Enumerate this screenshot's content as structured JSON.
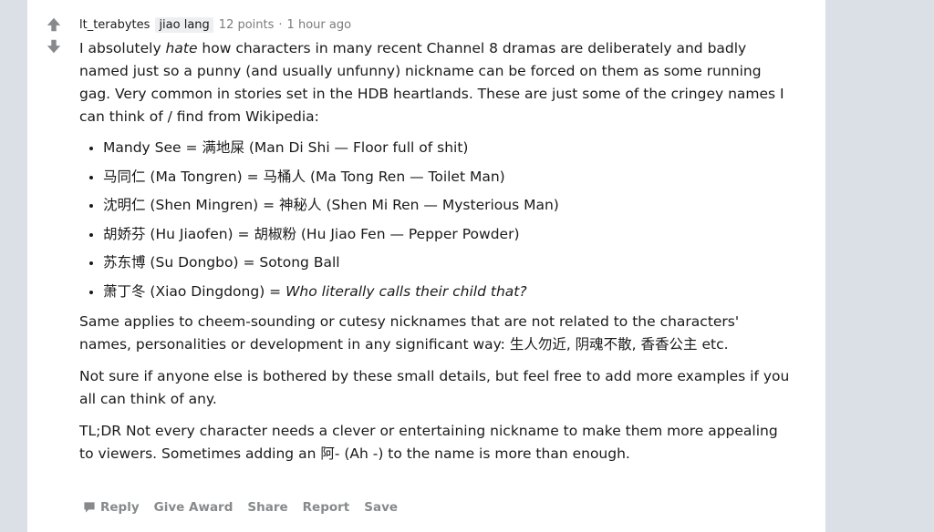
{
  "comment": {
    "author": "lt_terabytes",
    "flair": "jiao lang",
    "points": "12 points",
    "separator": "·",
    "time": "1 hour ago",
    "intro_1": "I absolutely ",
    "intro_em": "hate",
    "intro_2": " how characters in many recent Channel 8 dramas are deliberately and badly named just so a punny (and usually unfunny) nickname can be forced on them as some running gag. Very common in stories set in the HDB heartlands. These are just some of the cringey names I can think of / find from Wikipedia:",
    "list": [
      "Mandy See = 满地屎 (Man Di Shi — Floor full of shit)",
      "马同仁 (Ma Tongren) = 马桶人 (Ma Tong Ren — Toilet Man)",
      "沈明仁 (Shen Mingren) = 神秘人 (Shen Mi Ren — Mysterious Man)",
      "胡娇芬 (Hu Jiaofen) = 胡椒粉 (Hu Jiao Fen — Pepper Powder)",
      "苏东博 (Su Dongbo) = Sotong Ball"
    ],
    "list_last_plain": "萧丁冬 (Xiao Dingdong) = ",
    "list_last_em": "Who literally calls their child that?",
    "para_2": "Same applies to cheem-sounding or cutesy nicknames that are not related to the characters' names, personalities or development in any significant way: 生人勿近, 阴魂不散, 香香公主 etc.",
    "para_3": "Not sure if anyone else is bothered by these small details, but feel free to add more examples if you all can think of any.",
    "para_4": "TL;DR Not every character needs a clever or entertaining nickname to make them more appealing to viewers. Sometimes adding an 阿- (Ah -) to the name is more than enough."
  },
  "actions": {
    "reply": "Reply",
    "give_award": "Give Award",
    "share": "Share",
    "report": "Report",
    "save": "Save"
  },
  "icons": {
    "upvote": "upvote-arrow-icon",
    "downvote": "downvote-arrow-icon",
    "reply": "speech-bubble-icon"
  },
  "colors": {
    "vote_arrow": "#878a8c",
    "meta_text": "#7c7c7c",
    "flair_bg": "#edeff1",
    "action_text": "#878a8c",
    "page_bg": "#dae0e6"
  }
}
